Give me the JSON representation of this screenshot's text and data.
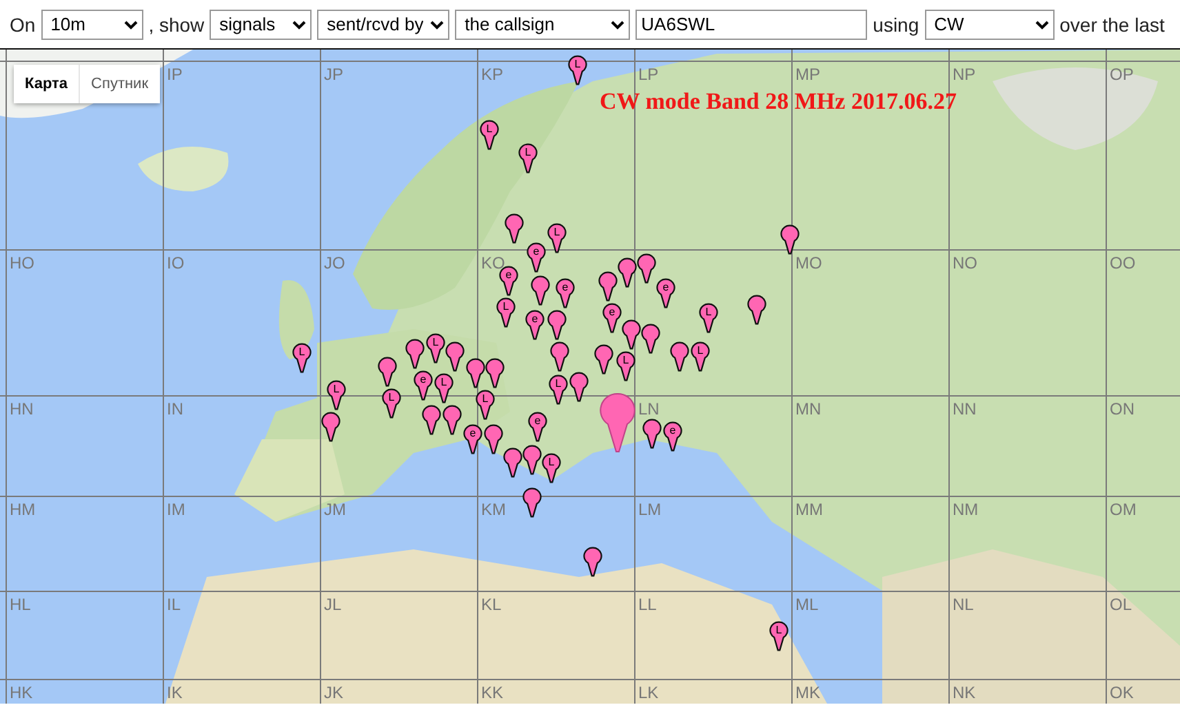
{
  "form": {
    "prefix": "On",
    "band": "10m",
    "show_label": ", show",
    "show": "signals",
    "direction": "sent/rcvd by",
    "target": "the callsign",
    "callsign": "UA6SWL",
    "using_label": "using",
    "mode": "CW",
    "suffix": "over the last"
  },
  "map": {
    "title": "CW mode Band 28 MHz 2017.06.27",
    "map_types": [
      {
        "label": "Карта",
        "selected": true
      },
      {
        "label": "Спутник",
        "selected": false
      }
    ],
    "grid_rows": [
      [
        "",
        "IP",
        "JP",
        "KP",
        "LP",
        "MP",
        "NP",
        "OP"
      ],
      [
        "HO",
        "IO",
        "JO",
        "KO",
        "",
        "MO",
        "NO",
        "OO"
      ],
      [
        "HN",
        "IN",
        "",
        "",
        "LN",
        "MN",
        "NN",
        "ON"
      ],
      [
        "HM",
        "IM",
        "JM",
        "KM",
        "LM",
        "MM",
        "NM",
        "OM"
      ],
      [
        "HL",
        "IL",
        "JL",
        "KL",
        "LL",
        "ML",
        "NL",
        "OL"
      ],
      [
        "HK",
        "IK",
        "JK",
        "KK",
        "LK",
        "MK",
        "NK",
        "OK"
      ]
    ],
    "markers": [
      {
        "kind": "letter",
        "label": "L"
      },
      {
        "kind": "letter",
        "label": "L"
      },
      {
        "kind": "letter",
        "label": "L"
      },
      {
        "kind": "plain"
      },
      {
        "kind": "letter",
        "label": "e"
      },
      {
        "kind": "letter",
        "label": "L"
      },
      {
        "kind": "plain"
      },
      {
        "kind": "letter",
        "label": "e"
      },
      {
        "kind": "letter",
        "label": "L"
      },
      {
        "kind": "letter",
        "label": "e"
      },
      {
        "kind": "plain"
      },
      {
        "kind": "letter",
        "label": "e"
      },
      {
        "kind": "plain"
      },
      {
        "kind": "plain"
      },
      {
        "kind": "letter",
        "label": "L"
      },
      {
        "kind": "plain"
      },
      {
        "kind": "plain"
      },
      {
        "kind": "plain"
      },
      {
        "kind": "letter",
        "label": "e"
      },
      {
        "kind": "letter",
        "label": "e"
      },
      {
        "kind": "plain"
      },
      {
        "kind": "plain"
      },
      {
        "kind": "letter",
        "label": "L"
      },
      {
        "kind": "plain"
      },
      {
        "kind": "letter",
        "label": "L"
      },
      {
        "kind": "letter",
        "label": "L"
      },
      {
        "kind": "plain"
      },
      {
        "kind": "plain"
      },
      {
        "kind": "plain"
      },
      {
        "kind": "large"
      },
      {
        "kind": "plain"
      },
      {
        "kind": "letter",
        "label": "e"
      },
      {
        "kind": "letter",
        "label": "L"
      },
      {
        "kind": "letter",
        "label": "L"
      },
      {
        "kind": "plain"
      },
      {
        "kind": "plain"
      },
      {
        "kind": "letter",
        "label": "L"
      },
      {
        "kind": "plain"
      },
      {
        "kind": "letter",
        "label": "L"
      },
      {
        "kind": "plain"
      },
      {
        "kind": "letter",
        "label": "e"
      },
      {
        "kind": "letter",
        "label": "L"
      },
      {
        "kind": "plain"
      },
      {
        "kind": "plain"
      },
      {
        "kind": "plain"
      },
      {
        "kind": "plain"
      },
      {
        "kind": "letter",
        "label": "L"
      },
      {
        "kind": "letter",
        "label": "e"
      },
      {
        "kind": "plain"
      },
      {
        "kind": "letter",
        "label": "e"
      },
      {
        "kind": "plain"
      },
      {
        "kind": "plain"
      },
      {
        "kind": "letter",
        "label": "L"
      },
      {
        "kind": "plain"
      },
      {
        "kind": "plain"
      },
      {
        "kind": "letter",
        "label": "L"
      }
    ]
  }
}
